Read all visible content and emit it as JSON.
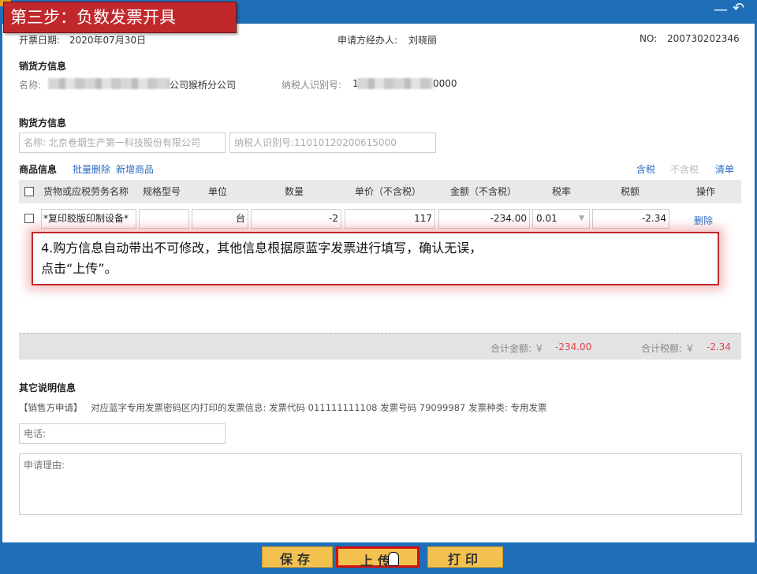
{
  "window": {
    "minimize_glyph": "—",
    "back_glyph": "↶"
  },
  "step_banner": "第三步：负数发票开具",
  "header": {
    "date_label": "开票日期:",
    "date_value": "2020年07月30日",
    "handler_label": "申请方经办人:",
    "handler_value": "刘晓丽",
    "no_label": "NO:",
    "no_value": "200730202346"
  },
  "seller": {
    "section_title": "销货方信息",
    "name_label": "名称:",
    "name_visible_suffix": "公司猴桥分公司",
    "taxid_label": "纳税人识别号:",
    "taxid_visible_prefix": "1",
    "taxid_visible_suffix": "0000"
  },
  "buyer": {
    "section_title": "购货方信息",
    "name_field": "名称: 北京卷烟生产第一科技股份有限公司",
    "taxid_field": "纳税人识别号:11010120200615000"
  },
  "goods": {
    "section_title": "商品信息",
    "batch_delete": "批量删除",
    "add_item": "新增商品",
    "tax_incl": "含税",
    "tax_excl": "不含税",
    "clear": "清单",
    "columns": [
      "货物或应税劳务名称",
      "规格型号",
      "单位",
      "数量",
      "单价（不含税）",
      "金额（不含税）",
      "税率",
      "税额",
      "操作"
    ],
    "row": {
      "name": "*复印胶版印制设备*",
      "spec": "",
      "unit": "台",
      "quantity": "-2",
      "unit_price": "117",
      "amount": "-234.00",
      "tax_rate": "0.01",
      "tax": "-2.34",
      "action": "删除"
    }
  },
  "callout": {
    "line1": "4.购方信息自动带出不可修改，其他信息根据原蓝字发票进行填写，确认无误，",
    "line2": "点击“上传”。"
  },
  "totals": {
    "amount_label": "合计金额: ￥",
    "amount_value": "-234.00",
    "tax_label": "合计税额: ￥",
    "tax_value": "-2.34"
  },
  "other": {
    "section_title": "其它说明信息",
    "note_tag": "【销售方申请】",
    "note_text": "对应蓝字专用发票密码区内打印的发票信息: 发票代码 011111111108 发票号码 79099987 发票种类: 专用发票",
    "phone_placeholder": "电话:",
    "reason_placeholder": "申请理由:"
  },
  "buttons": {
    "save": "保存",
    "upload": "上传",
    "print": "打印"
  },
  "colors": {
    "title_blue": "#1e6fb8",
    "banner_red": "#c0282c",
    "link_blue": "#2a6cc4",
    "negative_red": "#e0454a",
    "button_yellow": "#f2c14e"
  }
}
